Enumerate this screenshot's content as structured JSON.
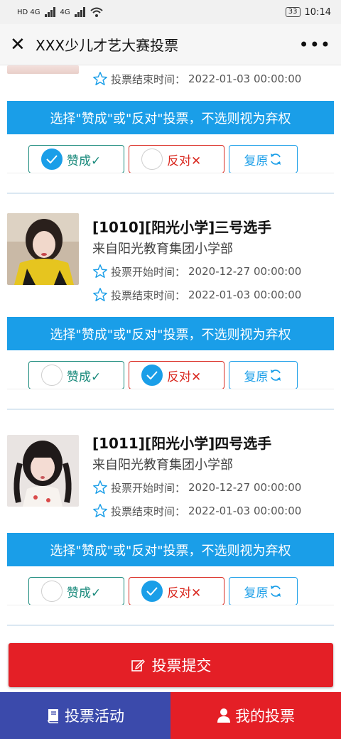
{
  "status_bar": {
    "network_left": "HD 4G",
    "network_right": "4G",
    "battery": "33",
    "time": "10:14"
  },
  "title_bar": {
    "title": "XXX少儿才艺大赛投票",
    "more": "•••"
  },
  "labels": {
    "start_prefix": "投票开始时间：",
    "end_prefix": "投票结束时间：",
    "banner": "选择\"赞成\"或\"反对\"投票，不选则视为弃权",
    "yes": "赞成✓",
    "no": "反对✕",
    "reset": "复原"
  },
  "contestants": [
    {
      "end_time": "2022-01-03 00:00:00",
      "selected": "yes"
    },
    {
      "title": "[1010][阳光小学]三号选手",
      "org": "来自阳光教育集团小学部",
      "start_time": "2020-12-27 00:00:00",
      "end_time": "2022-01-03 00:00:00",
      "selected": "no"
    },
    {
      "title": "[1011][阳光小学]四号选手",
      "org": "来自阳光教育集团小学部",
      "start_time": "2020-12-27 00:00:00",
      "end_time": "2022-01-03 00:00:00",
      "selected": "no"
    }
  ],
  "submit": {
    "label": "投票提交",
    "icon": "edit-icon"
  },
  "bottom_nav": {
    "left_label": "投票活动",
    "left_icon": "book-icon",
    "right_label": "我的投票",
    "right_icon": "user-icon"
  },
  "colors": {
    "banner_blue": "#1a9ee8",
    "yes_green": "#1a8a7c",
    "no_red": "#d9281f",
    "submit_red": "#e41f26",
    "nav_blue": "#3b4aab"
  }
}
